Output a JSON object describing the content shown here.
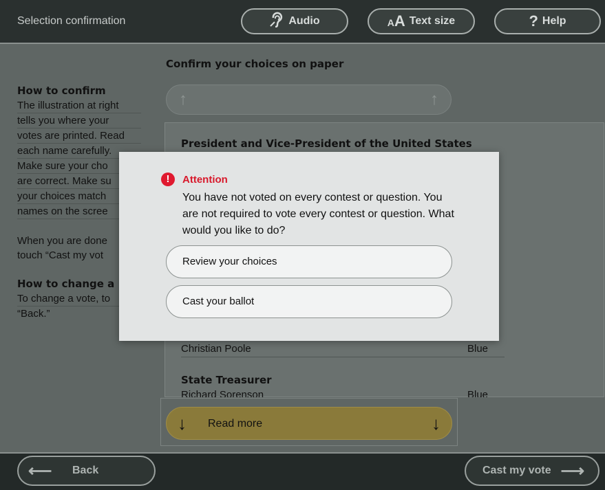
{
  "header": {
    "title": "Selection confirmation",
    "audio_label": "Audio",
    "text_size_label": "Text size",
    "help_label": "Help"
  },
  "instructions": {
    "confirm_heading": "How to confirm",
    "confirm_lines": [
      "The illustration at right",
      "tells you where your",
      "votes are printed. Read",
      "each name carefully.",
      "Make sure your cho",
      "are correct. Make su",
      "your choices match",
      "names on the scree"
    ],
    "done_lines": [
      "When you are done",
      "touch “Cast my vot"
    ],
    "change_heading": "How to change a",
    "change_lines": [
      "To change a vote, to",
      "“Back.”"
    ]
  },
  "main": {
    "title": "Confirm your choices on paper",
    "contests": [
      {
        "title": "President and Vice-President of the United States"
      },
      {
        "title": "State Treasurer"
      }
    ],
    "candidates": [
      {
        "name": "Christian Poole",
        "party": "Blue"
      },
      {
        "name": "Richard Sorenson",
        "party": "Blue"
      }
    ],
    "read_more_label": "Read more"
  },
  "footer": {
    "back_label": "Back",
    "cast_label": "Cast my vote"
  },
  "dialog": {
    "title": "Attention",
    "message": "You have not voted on every contest or question. You are not required to vote every contest or question. What would you like to do?",
    "review_label": "Review your choices",
    "cast_label": "Cast your ballot"
  },
  "colors": {
    "background": "#5f6664",
    "alert": "#d8192b",
    "read_more": "#8a7a3a"
  }
}
